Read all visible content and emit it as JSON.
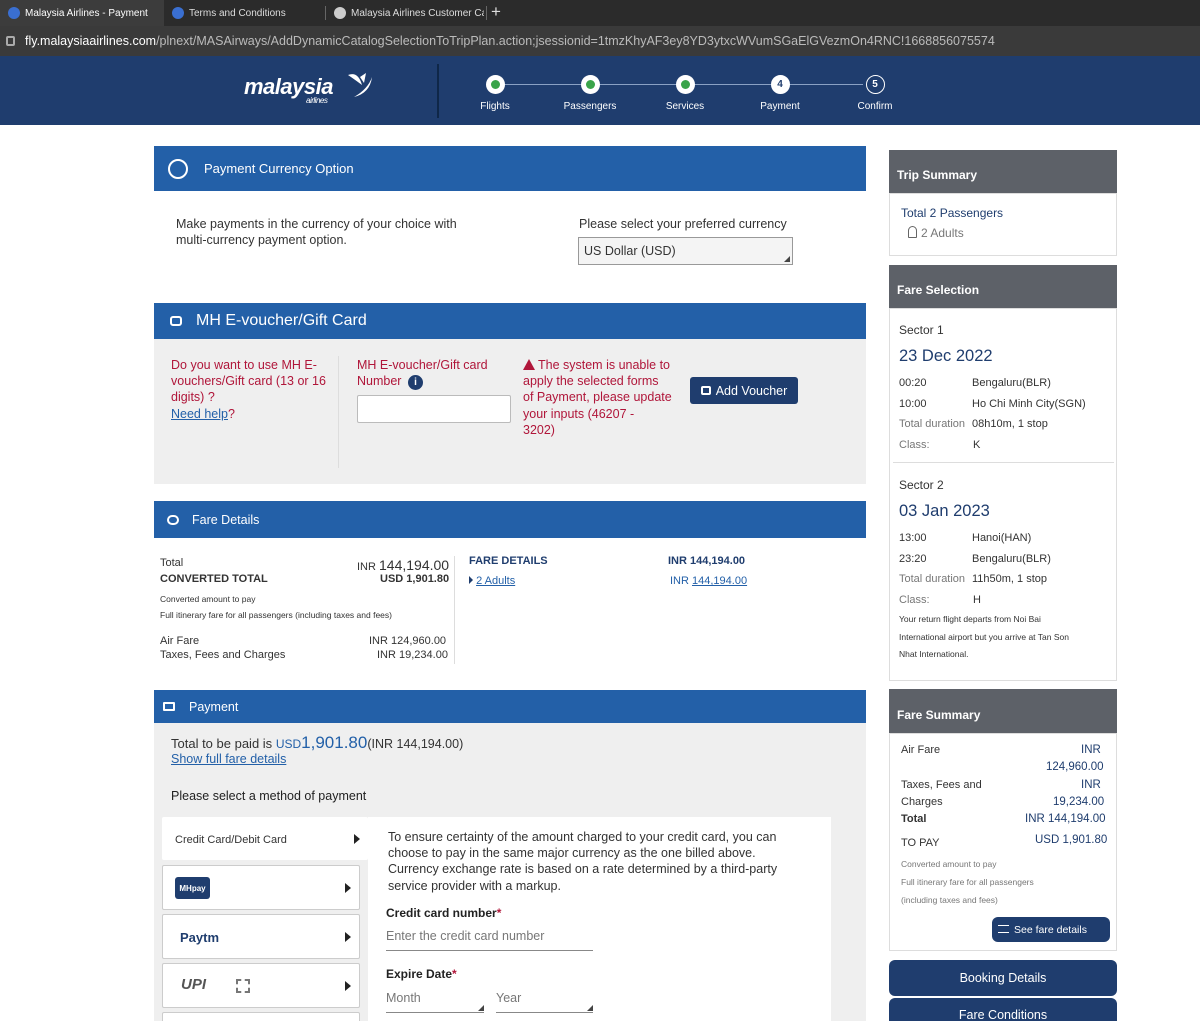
{
  "browser": {
    "tabs": [
      {
        "title": "Malaysia Airlines - Payment"
      },
      {
        "title": "Terms and Conditions"
      },
      {
        "title": "Malaysia Airlines Customer Car"
      }
    ],
    "url_host": "fly.malaysiaairlines.com",
    "url_path": "/plnext/MASAirways/AddDynamicCatalogSelectionToTripPlan.action;jsessionid=1tmzKhyAF3ey8YD3ytxcWVumSGaElGVezmOn4RNC!1668856075574"
  },
  "header": {
    "logo": "malaysia",
    "logo_sub": "airlines",
    "steps": [
      {
        "label": "Flights",
        "state": "done",
        "num": ""
      },
      {
        "label": "Passengers",
        "state": "done",
        "num": ""
      },
      {
        "label": "Services",
        "state": "done",
        "num": ""
      },
      {
        "label": "Payment",
        "state": "current",
        "num": "4"
      },
      {
        "label": "Confirm",
        "state": "next",
        "num": "5"
      }
    ]
  },
  "currency": {
    "title": "Payment Currency Option",
    "desc_line1": "Make payments in the currency of your choice with",
    "desc_line2": "multi-currency payment option.",
    "select_label": "Please select your preferred currency",
    "selected": "US Dollar (USD)"
  },
  "voucher": {
    "title": "MH E-voucher/Gift Card",
    "question_l1": "Do you want to use MH E-",
    "question_l2": "vouchers/Gift card (13 or 16",
    "question_l3": "digits) ?",
    "need_help": "Need help",
    "qmark": "?",
    "number_label_l1": "MH E-voucher/Gift card",
    "number_label_l2": "Number",
    "error_l1": "The system is unable to",
    "error_l2": "apply the selected forms",
    "error_l3": "of Payment, please update",
    "error_l4": "your inputs (46207 -",
    "error_l5": "3202)",
    "add_button": "Add Voucher"
  },
  "fare_details": {
    "title": "Fare Details",
    "total_label": "Total",
    "total_value": "INR 144,194.00",
    "total_currency": "INR",
    "total_amount": "144,194.00",
    "converted_label": "CONVERTED TOTAL",
    "converted_value": "USD 1,901.80",
    "converted_note": "Converted amount to pay",
    "itinerary_note": "Full itinerary fare for all passengers (including taxes and fees)",
    "air_fare_label": "Air Fare",
    "air_fare_value": "INR 124,960.00",
    "taxes_label": "Taxes, Fees and Charges",
    "taxes_value": "INR 19,234.00",
    "col_header": "FARE DETAILS",
    "col_header_value": "INR 144,194.00",
    "adults_link": "2 Adults",
    "adults_currency": "INR",
    "adults_value": "144,194.00"
  },
  "payment": {
    "title": "Payment",
    "total_prefix": "Total to be paid is",
    "total_currency": "USD",
    "total_amount": "1,901.80",
    "total_inr": "(INR 144,194.00)",
    "show_full": "Show full fare details",
    "select_method": "Please select a method of payment",
    "methods": [
      {
        "label": "Credit Card/Debit Card"
      },
      {
        "label": "MHpay"
      },
      {
        "label": "Paytm"
      },
      {
        "label": "UPI"
      }
    ],
    "cc_info_l1": "To ensure certainty of the amount charged to your credit card, you can",
    "cc_info_l2": "choose to pay in the same major currency as the one billed above.",
    "cc_info_l3": "Currency exchange rate is based on a rate determined by a third-party",
    "cc_info_l4": "service provider with a markup.",
    "cc_number_label": "Credit card number",
    "cc_number_placeholder": "Enter the credit card number",
    "expire_label": "Expire Date",
    "required_mark": "*",
    "month_placeholder": "Month",
    "year_placeholder": "Year"
  },
  "sidebar": {
    "trip_summary": "Trip Summary",
    "total_passengers": "Total 2 Passengers",
    "adults": "2 Adults",
    "fare_selection": "Fare Selection",
    "sector1": {
      "label": "Sector 1",
      "date": "23 Dec 2022",
      "dep_time": "00:20",
      "dep_city": "Bengaluru(BLR)",
      "arr_time": "10:00",
      "arr_city": "Ho Chi Minh City(SGN)",
      "duration_label": "Total duration",
      "duration": "08h10m, 1 stop",
      "class_label": "Class:",
      "class": "K"
    },
    "sector2": {
      "label": "Sector 2",
      "date": "03 Jan 2023",
      "dep_time": "13:00",
      "dep_city": "Hanoi(HAN)",
      "arr_time": "23:20",
      "arr_city": "Bengaluru(BLR)",
      "duration_label": "Total duration",
      "duration": "11h50m, 1 stop",
      "class_label": "Class:",
      "class": "H",
      "warning_l1": "Your return flight departs from Noi Bai",
      "warning_l2": "International airport but you arrive at Tan Son",
      "warning_l3": "Nhat International."
    },
    "fare_summary": "Fare Summary",
    "air_fare_label": "Air Fare",
    "air_fare_cur": "INR",
    "air_fare_value": "124,960.00",
    "taxes_label_l1": "Taxes, Fees and",
    "taxes_label_l2": "Charges",
    "taxes_cur": "INR",
    "taxes_value": "19,234.00",
    "total_label": "Total",
    "total_value": "INR 144,194.00",
    "to_pay_label": "TO PAY",
    "to_pay_value": "USD 1,901.80",
    "note1": "Converted amount to pay",
    "note2": "Full itinerary fare for all passengers",
    "note3": "(including taxes and fees)",
    "see_fare": "See fare details",
    "booking_details": "Booking Details",
    "fare_conditions": "Fare Conditions"
  },
  "colors": {
    "header_navy": "#1f3d6e",
    "section_blue": "#2360a8",
    "error_red": "#b0163a",
    "sidebar_head_grey": "#5d6168"
  }
}
